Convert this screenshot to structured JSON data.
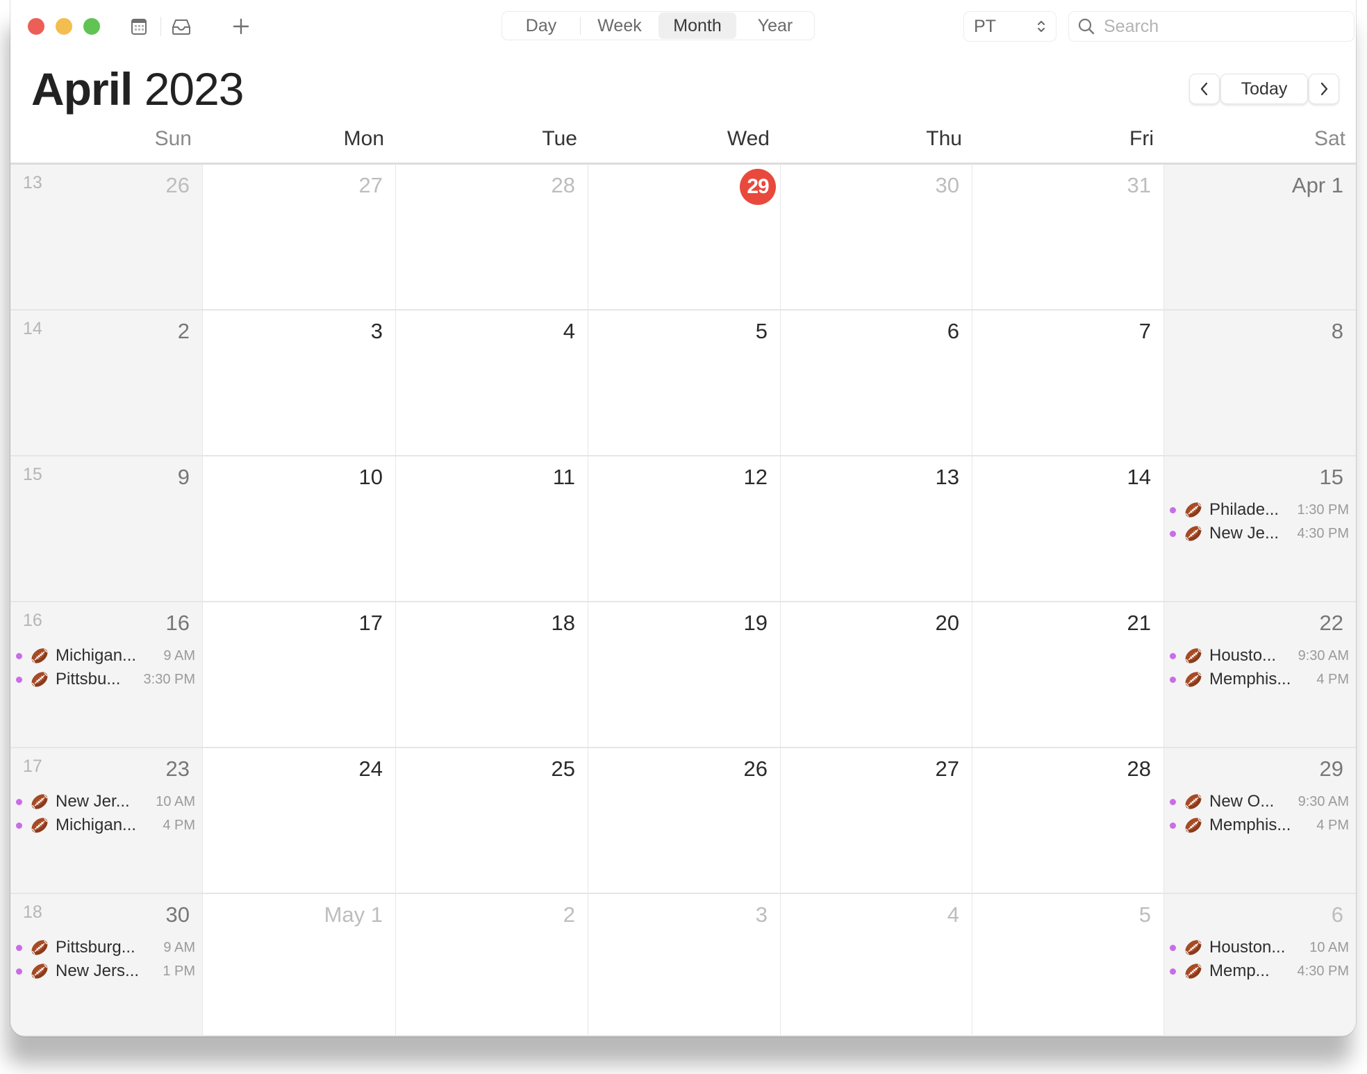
{
  "toolbar": {
    "views": [
      {
        "label": "Day",
        "active": false
      },
      {
        "label": "Week",
        "active": false
      },
      {
        "label": "Month",
        "active": true
      },
      {
        "label": "Year",
        "active": false
      }
    ],
    "timezone": "PT",
    "search_placeholder": "Search",
    "icons": [
      "calendars-icon",
      "inbox-icon",
      "add-icon"
    ]
  },
  "header": {
    "month": "April",
    "year": "2023",
    "today_label": "Today"
  },
  "weekdays": [
    "Sun",
    "Mon",
    "Tue",
    "Wed",
    "Thu",
    "Fri",
    "Sat"
  ],
  "accent": {
    "today": "#e8493c",
    "event_dot": "#c96ce8"
  },
  "weeks": [
    {
      "week_number": "13",
      "days": [
        {
          "label": "26",
          "style": "dim"
        },
        {
          "label": "27",
          "style": "dim"
        },
        {
          "label": "28",
          "style": "dim"
        },
        {
          "label": "29",
          "style": "today"
        },
        {
          "label": "30",
          "style": "dim"
        },
        {
          "label": "31",
          "style": "dim"
        },
        {
          "label": "Apr 1",
          "style": "weekend",
          "events": []
        }
      ]
    },
    {
      "week_number": "14",
      "days": [
        {
          "label": "2",
          "style": "weekend"
        },
        {
          "label": "3",
          "style": "normal"
        },
        {
          "label": "4",
          "style": "normal"
        },
        {
          "label": "5",
          "style": "normal"
        },
        {
          "label": "6",
          "style": "normal"
        },
        {
          "label": "7",
          "style": "normal"
        },
        {
          "label": "8",
          "style": "weekend"
        }
      ]
    },
    {
      "week_number": "15",
      "days": [
        {
          "label": "9",
          "style": "weekend"
        },
        {
          "label": "10",
          "style": "normal"
        },
        {
          "label": "11",
          "style": "normal"
        },
        {
          "label": "12",
          "style": "normal"
        },
        {
          "label": "13",
          "style": "normal"
        },
        {
          "label": "14",
          "style": "normal"
        },
        {
          "label": "15",
          "style": "weekend",
          "events": [
            {
              "title": "Philade...",
              "time": "1:30 PM"
            },
            {
              "title": "New Je...",
              "time": "4:30 PM"
            }
          ]
        }
      ]
    },
    {
      "week_number": "16",
      "days": [
        {
          "label": "16",
          "style": "weekend",
          "events": [
            {
              "title": "Michigan...",
              "time": "9 AM"
            },
            {
              "title": "Pittsbu...",
              "time": "3:30 PM"
            }
          ]
        },
        {
          "label": "17",
          "style": "normal"
        },
        {
          "label": "18",
          "style": "normal"
        },
        {
          "label": "19",
          "style": "normal"
        },
        {
          "label": "20",
          "style": "normal"
        },
        {
          "label": "21",
          "style": "normal"
        },
        {
          "label": "22",
          "style": "weekend",
          "events": [
            {
              "title": "Housto...",
              "time": "9:30 AM"
            },
            {
              "title": "Memphis...",
              "time": "4 PM"
            }
          ]
        }
      ]
    },
    {
      "week_number": "17",
      "days": [
        {
          "label": "23",
          "style": "weekend",
          "events": [
            {
              "title": "New Jer...",
              "time": "10 AM"
            },
            {
              "title": "Michigan...",
              "time": "4 PM"
            }
          ]
        },
        {
          "label": "24",
          "style": "normal"
        },
        {
          "label": "25",
          "style": "normal"
        },
        {
          "label": "26",
          "style": "normal"
        },
        {
          "label": "27",
          "style": "normal"
        },
        {
          "label": "28",
          "style": "normal"
        },
        {
          "label": "29",
          "style": "weekend",
          "events": [
            {
              "title": "New O...",
              "time": "9:30 AM"
            },
            {
              "title": "Memphis...",
              "time": "4 PM"
            }
          ]
        }
      ]
    },
    {
      "week_number": "18",
      "days": [
        {
          "label": "30",
          "style": "weekend",
          "events": [
            {
              "title": "Pittsburg...",
              "time": "9 AM"
            },
            {
              "title": "New Jers...",
              "time": "1 PM"
            }
          ]
        },
        {
          "label": "May 1",
          "style": "dim"
        },
        {
          "label": "2",
          "style": "dim"
        },
        {
          "label": "3",
          "style": "dim"
        },
        {
          "label": "4",
          "style": "dim"
        },
        {
          "label": "5",
          "style": "dim"
        },
        {
          "label": "6",
          "style": "dim",
          "events": [
            {
              "title": "Houston...",
              "time": "10 AM"
            },
            {
              "title": "Memp...",
              "time": "4:30 PM"
            }
          ]
        }
      ]
    }
  ]
}
